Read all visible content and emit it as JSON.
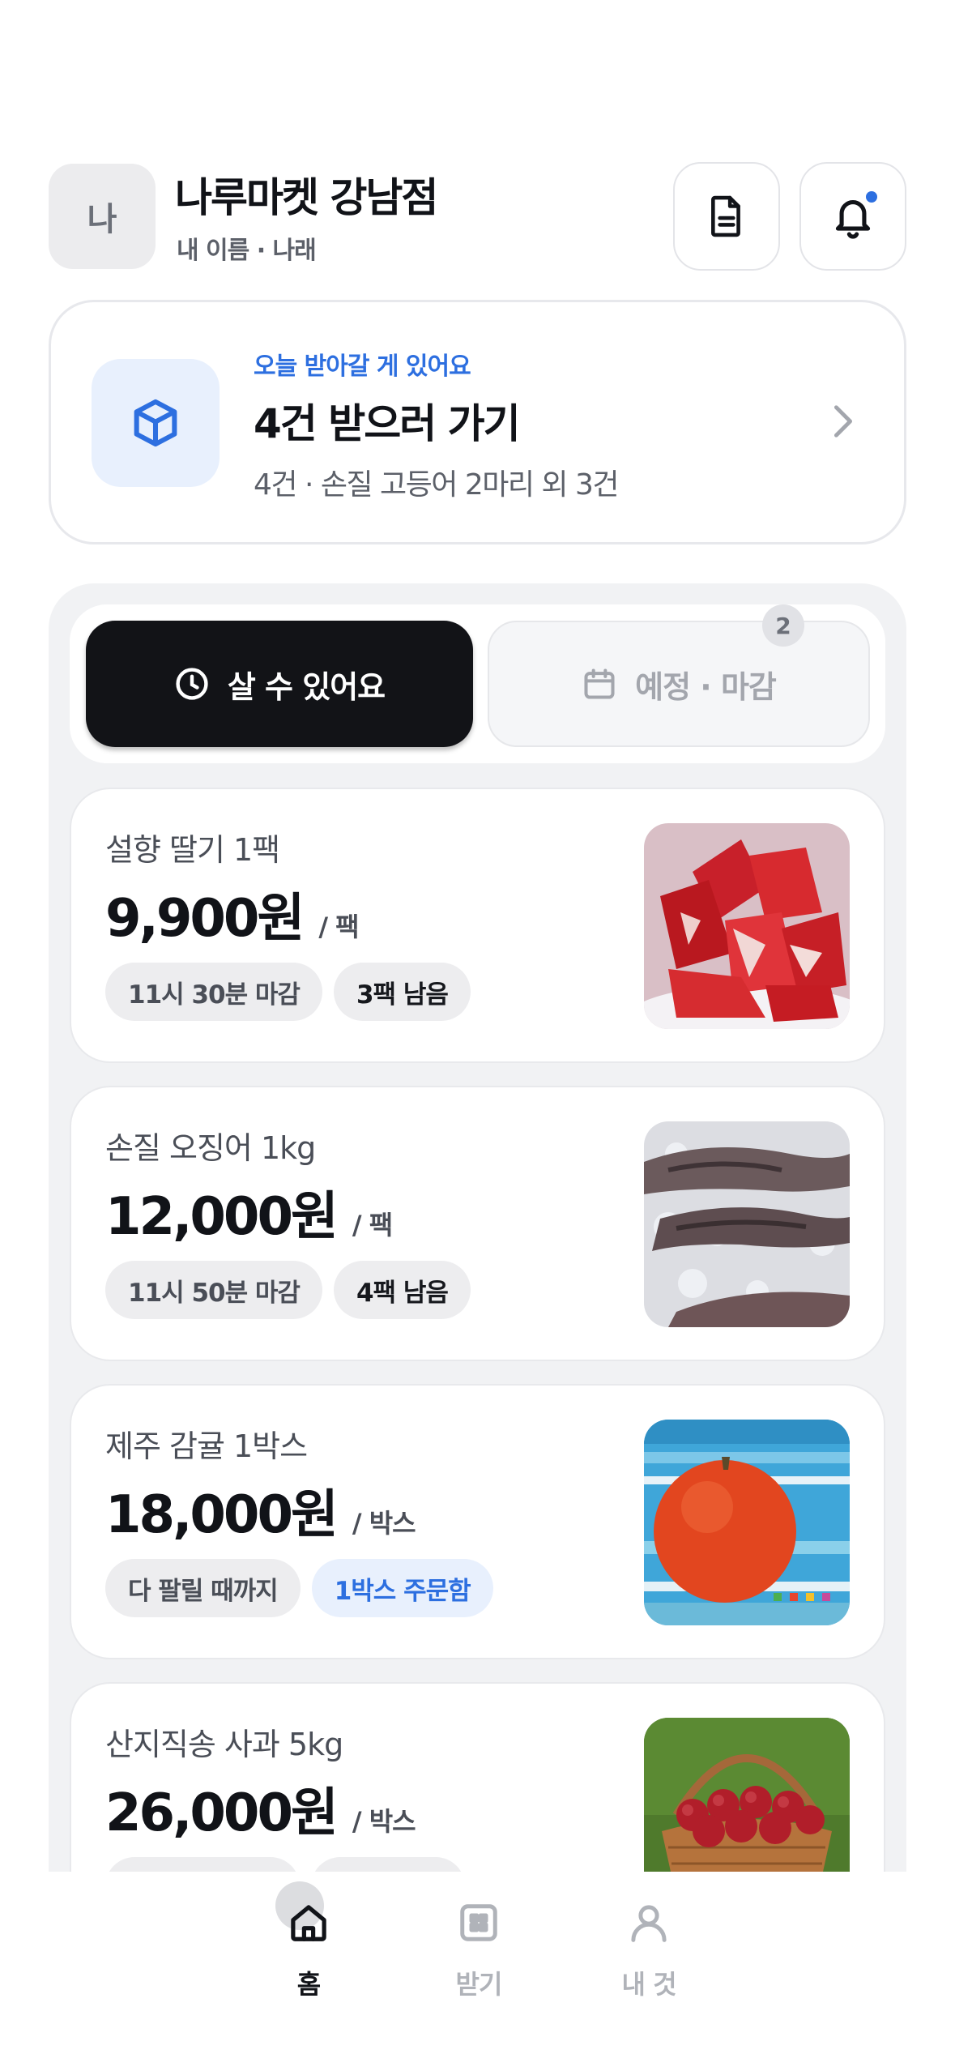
{
  "header": {
    "avatar_initial": "나",
    "store_name": "나루마켓 강남점",
    "store_sub": "내 이름 · 나래"
  },
  "pickup": {
    "eyebrow": "오늘 받아갈 게 있어요",
    "title": "4건 받으러 가기",
    "description": "4건 · 손질 고등어 2마리 외 3건"
  },
  "tabs": {
    "available": "살 수 있어요",
    "scheduled": "예정 · 마감",
    "scheduled_count": "2"
  },
  "products": [
    {
      "name": "설향 딸기 1팩",
      "price": "9,900원",
      "unit": "/ 팩",
      "chip1": "11시 30분 마감",
      "chip2": "3팩 남음"
    },
    {
      "name": "손질 오징어 1kg",
      "price": "12,000원",
      "unit": "/ 팩",
      "chip1": "11시 50분 마감",
      "chip2": "4팩 남음"
    },
    {
      "name": "제주 감귤 1박스",
      "price": "18,000원",
      "unit": "/ 박스",
      "chip1": "다 팔릴 때까지",
      "chip2": "1박스 주문함"
    },
    {
      "name": "산지직송 사과 5kg",
      "price": "26,000원",
      "unit": "/ 박스",
      "chip1": "",
      "chip2": ""
    }
  ],
  "nav": {
    "home": "홈",
    "receive": "받기",
    "mine": "내 것"
  },
  "colors": {
    "accent": "#2d6fe0",
    "dark": "#121317",
    "panel": "#f1f2f4"
  },
  "icons": {
    "doc": "document-icon",
    "bell": "bell-icon",
    "box": "box-icon",
    "clock": "clock-icon",
    "calendar": "calendar-icon"
  }
}
